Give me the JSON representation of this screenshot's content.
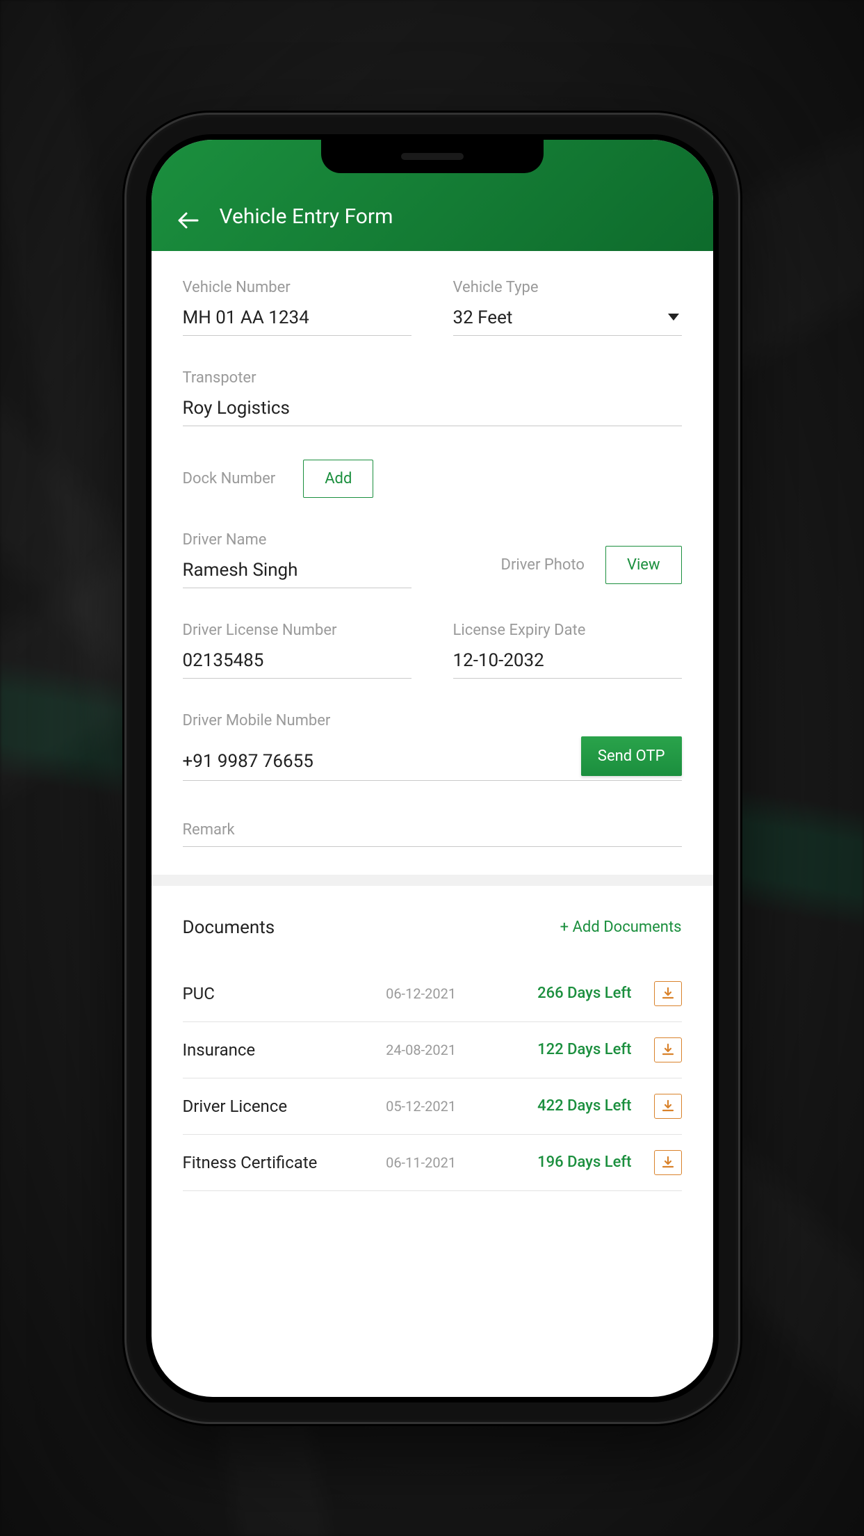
{
  "header": {
    "title": "Vehicle Entry Form"
  },
  "form": {
    "vehicleNumber": {
      "label": "Vehicle Number",
      "value": "MH 01 AA 1234"
    },
    "vehicleType": {
      "label": "Vehicle Type",
      "value": "32 Feet"
    },
    "transporter": {
      "label": "Transpoter",
      "value": "Roy Logistics"
    },
    "dockNumber": {
      "label": "Dock Number",
      "addLabel": "Add"
    },
    "driverName": {
      "label": "Driver Name",
      "value": "Ramesh Singh"
    },
    "driverPhoto": {
      "label": "Driver Photo",
      "viewLabel": "View"
    },
    "driverLicense": {
      "label": "Driver License Number",
      "value": "02135485"
    },
    "licenseExpiry": {
      "label": "License Expiry Date",
      "value": "12-10-2032"
    },
    "driverMobile": {
      "label": "Driver Mobile Number",
      "value": "+91 9987 76655",
      "otpLabel": "Send OTP"
    },
    "remark": {
      "label": "Remark",
      "value": ""
    }
  },
  "documents": {
    "title": "Documents",
    "addLabel": "+ Add Documents",
    "items": [
      {
        "name": "PUC",
        "date": "06-12-2021",
        "daysLeft": "266 Days Left"
      },
      {
        "name": "Insurance",
        "date": "24-08-2021",
        "daysLeft": "122 Days Left"
      },
      {
        "name": "Driver Licence",
        "date": "05-12-2021",
        "daysLeft": "422 Days Left"
      },
      {
        "name": "Fitness Certificate",
        "date": "06-11-2021",
        "daysLeft": "196 Days Left"
      }
    ]
  },
  "colors": {
    "accent": "#1b8f3e",
    "download": "#d9822b"
  }
}
